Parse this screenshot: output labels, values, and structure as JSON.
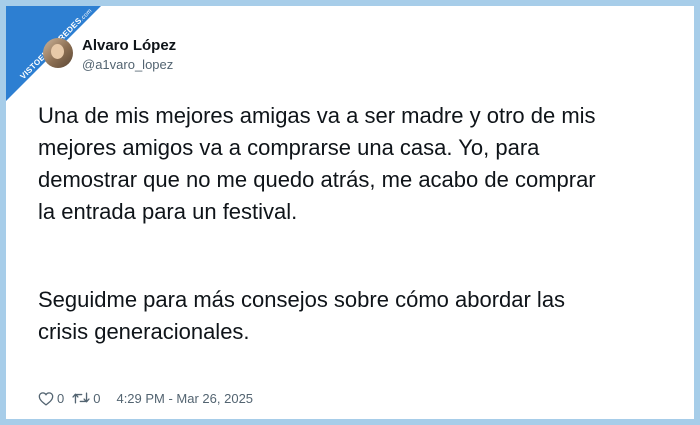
{
  "watermark": {
    "text": "VISTOENLASREDES",
    "tld": ".com"
  },
  "author": {
    "name": "Alvaro López",
    "handle": "@a1varo_lopez"
  },
  "tweet": {
    "paragraph1": "Una de mis mejores amigas va a ser madre y otro de mis\nmejores amigos va a comprarse una casa. Yo, para\ndemostrar que no me quedo atrás, me acabo de comprar\nla entrada para un festival.",
    "paragraph2": "Seguidme para más consejos sobre cómo abordar las\ncrisis generacionales."
  },
  "stats": {
    "likes": "0",
    "retweets": "0"
  },
  "timestamp": "4:29 PM - Mar 26, 2025",
  "icons": {
    "like": "heart-icon",
    "retweet": "retweet-icon"
  },
  "colors": {
    "background": "#a7cde9",
    "badge": "#2d7fd2",
    "text": "#0f1419",
    "muted": "#536471"
  }
}
